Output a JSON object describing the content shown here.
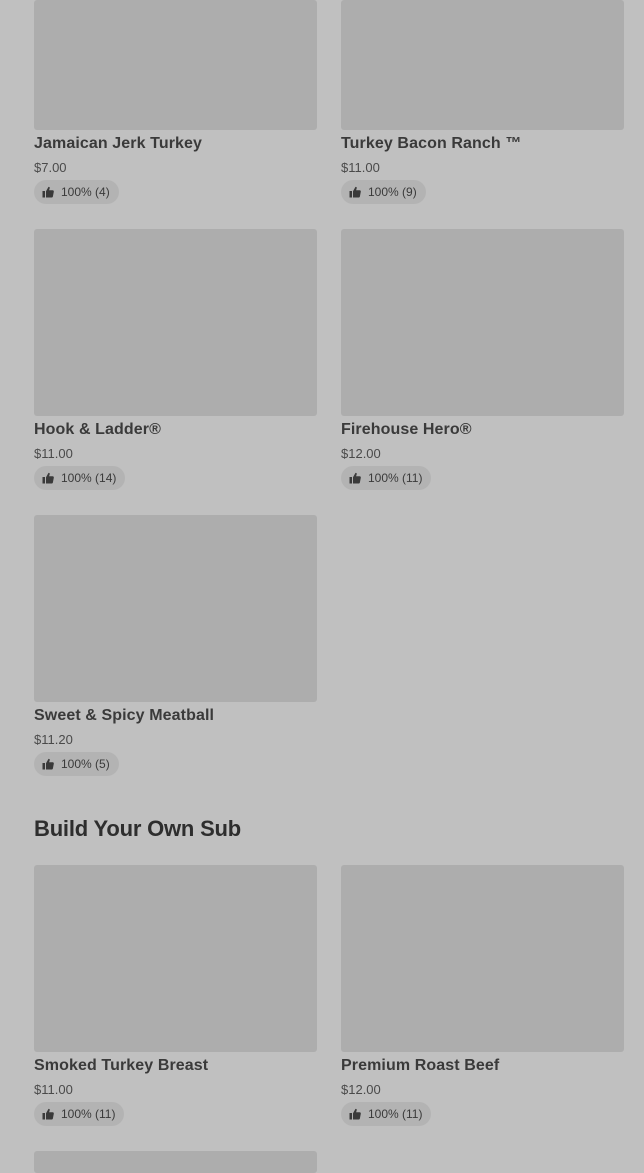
{
  "items": [
    {
      "name": "Jamaican Jerk Turkey",
      "price": "$7.00",
      "rating": "100% (4)",
      "icon": "thumbs-up-icon"
    },
    {
      "name": "Turkey Bacon Ranch ™",
      "price": "$11.00",
      "rating": "100% (9)",
      "icon": "thumbs-up-icon"
    },
    {
      "name": "Hook & Ladder®",
      "price": "$11.00",
      "rating": "100% (14)",
      "icon": "thumbs-up-icon"
    },
    {
      "name": "Firehouse Hero®",
      "price": "$12.00",
      "rating": "100% (11)",
      "icon": "thumbs-up-icon"
    },
    {
      "name": "Sweet & Spicy Meatball",
      "price": "$11.20",
      "rating": "100% (5)",
      "icon": "thumbs-up-icon"
    }
  ],
  "build_section": {
    "title": "Build Your Own Sub",
    "items": [
      {
        "name": "Smoked Turkey Breast",
        "price": "$11.00",
        "rating": "100% (11)",
        "icon": "thumbs-up-icon"
      },
      {
        "name": "Premium Roast Beef",
        "price": "$12.00",
        "rating": "100% (11)",
        "icon": "thumbs-up-icon"
      }
    ]
  }
}
